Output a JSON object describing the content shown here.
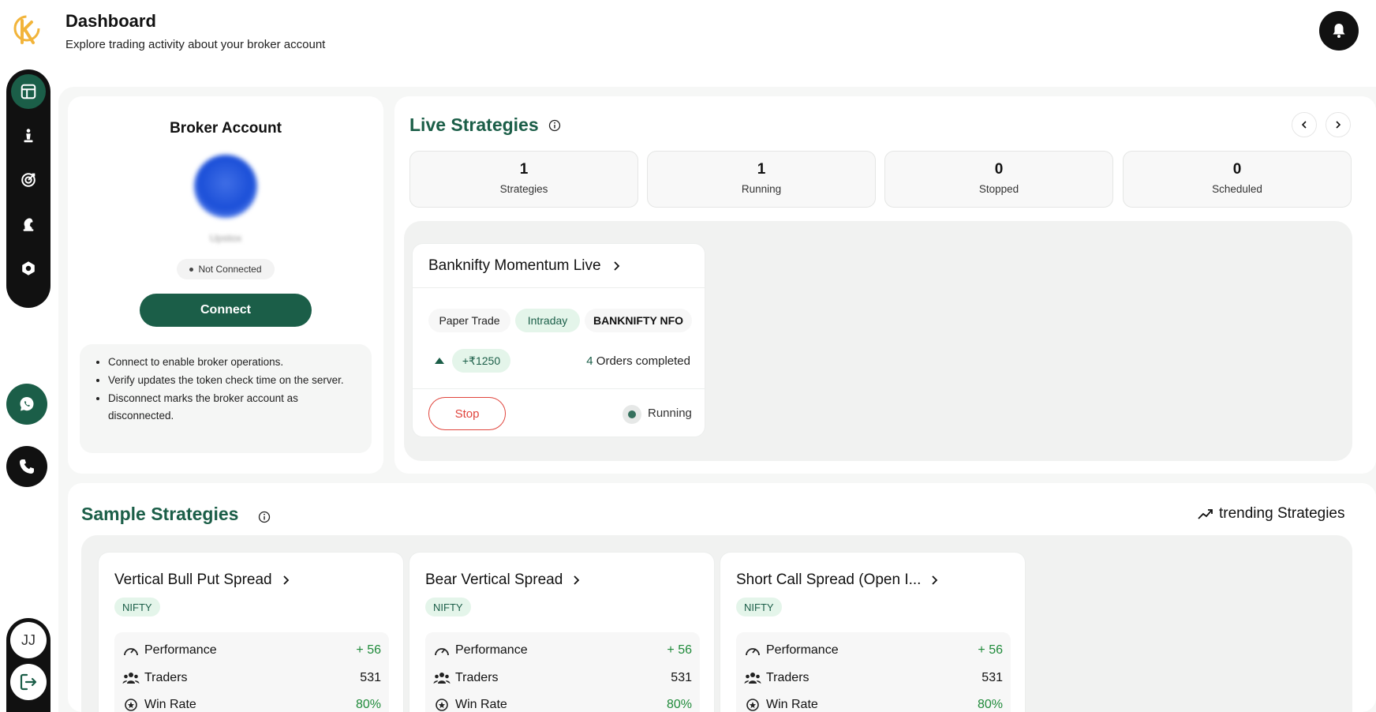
{
  "header": {
    "title": "Dashboard",
    "subtitle": "Explore trading activity about your broker account"
  },
  "sidebar": {
    "nav": [
      {
        "name": "dashboard",
        "icon": "dashboard-icon",
        "active": true
      },
      {
        "name": "strategies",
        "icon": "chess-pawn-icon",
        "active": false
      },
      {
        "name": "targets",
        "icon": "target-icon",
        "active": false
      },
      {
        "name": "chess-knight",
        "icon": "chess-knight-icon",
        "active": false
      },
      {
        "name": "settings",
        "icon": "hexagon-nut-icon",
        "active": false
      }
    ],
    "user_initials": "JJ"
  },
  "broker": {
    "title": "Broker Account",
    "name": "Upstox",
    "status": "Not Connected",
    "connect_label": "Connect",
    "info": [
      "Connect to enable broker operations.",
      "Verify updates the token check time on the server.",
      "Disconnect marks the broker account as disconnected."
    ]
  },
  "live": {
    "title": "Live Strategies",
    "stats": [
      {
        "value": "1",
        "label": "Strategies"
      },
      {
        "value": "1",
        "label": "Running"
      },
      {
        "value": "0",
        "label": "Stopped"
      },
      {
        "value": "0",
        "label": "Scheduled"
      }
    ],
    "strategy": {
      "name": "Banknifty Momentum Live",
      "tags": [
        "Paper Trade",
        "Intraday",
        "BANKNIFTY NFO"
      ],
      "pnl": "+₹1250",
      "orders_count": "4",
      "orders_text": " Orders completed",
      "stop_label": "Stop",
      "status": "Running"
    }
  },
  "sample": {
    "title": "Sample Strategies",
    "trending_label": "trending Strategies",
    "metric_labels": {
      "performance": "Performance",
      "traders": "Traders",
      "winrate": "Win Rate"
    },
    "cards": [
      {
        "title": "Vertical Bull Put Spread",
        "tag": "NIFTY",
        "performance": "+ 56",
        "traders": "531",
        "win_rate": "80%"
      },
      {
        "title": "Bear Vertical Spread",
        "tag": "NIFTY",
        "performance": "+ 56",
        "traders": "531",
        "win_rate": "80%"
      },
      {
        "title": "Short Call Spread (Open I...",
        "tag": "NIFTY",
        "performance": "+ 56",
        "traders": "531",
        "win_rate": "80%"
      }
    ]
  },
  "colors": {
    "brand": "#1b5e48",
    "danger": "#e0443c",
    "positive": "#1f8a3a",
    "sidebar": "#111111"
  }
}
